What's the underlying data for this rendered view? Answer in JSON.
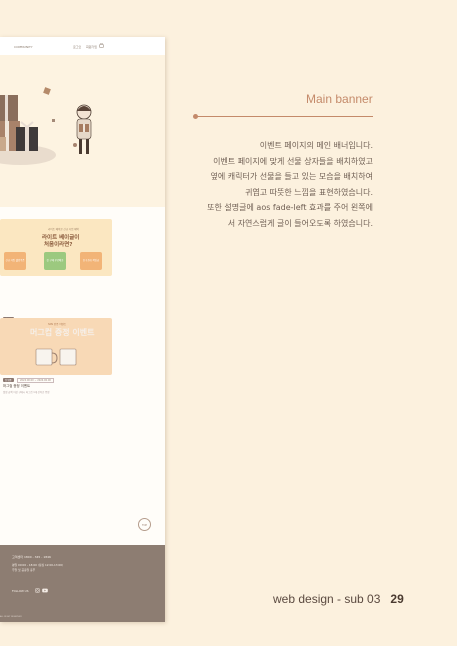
{
  "mockup": {
    "nav": {
      "left": "COMMUNITY",
      "right_a": "로그인",
      "right_b": "회원가입"
    },
    "section": {
      "title": "oll",
      "subtitle": "다양한 이벤트를 놓치지 마세요"
    },
    "cards": [
      {
        "banner_small": "라이트 베이글 신규 가입 혜택",
        "banner_title_1": "라이트 베이글이",
        "banner_title_2": "처음이라면?",
        "chips": [
          "신규 가입 웰컴쿠폰",
          "첫 구매 무료배송",
          "친구초대 적립금"
        ],
        "tag": "진행중",
        "title": "라이트 베이글 신규 가입 & 첫 구매 혜택",
        "desc": "첫 구매 무료배송 & 친구 초대 적립금 & 웰컴쿠폰 증정 이벤트"
      },
      {
        "banner_small": "SNS 인증 이벤트",
        "banner_title": "머그컵 증정 이벤트",
        "tag": "진행중",
        "period": "2024.00.00 ~ 2024.00.00",
        "title": "머그컵 증정 이벤트",
        "desc": "일정 금액 이상 구매시 머그컵 1개 선착순 증정"
      }
    ],
    "top_button": "TOP",
    "footer": {
      "phone": "고객센터  1800 - 345 - 1846",
      "hours_1": "평일 09:00 - 18:00 (점심 12:00-13:00)",
      "hours_2": "주말 및 공휴일 휴무",
      "follow": "FOLLOW US",
      "copyright": "ALL RIGHT RESERVED"
    }
  },
  "panel": {
    "heading": "Main banner",
    "description": [
      "이벤트 페이지의 메인 배너입니다.",
      "이벤트 페이지에 맞게 선물 상자들을 배치하였고",
      "옆에 캐릭터가 선물을 들고 있는 모습을 배치하여",
      "귀엽고 따뜻한 느낌을 표현하였습니다.",
      "또한 설명글에 aos fade-left 효과를 주어 왼쪽에",
      "서 자연스럽게 글이 들어오도록 하였습니다."
    ]
  },
  "page_footer": {
    "label": "web design - sub 03",
    "number": "29"
  },
  "colors": {
    "background": "#fcf1de",
    "accent": "#c48a6a",
    "footer_brown": "#8d7d72"
  }
}
